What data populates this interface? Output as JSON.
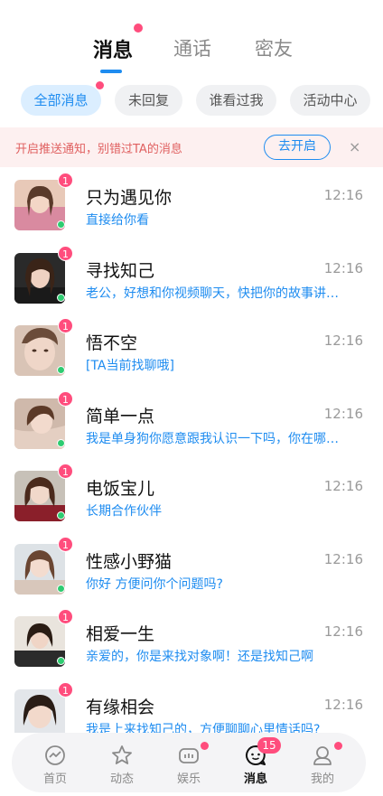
{
  "top_tabs": [
    {
      "label": "消息",
      "active": true
    },
    {
      "label": "通话",
      "active": false
    },
    {
      "label": "密友",
      "active": false
    }
  ],
  "filters": [
    {
      "label": "全部消息",
      "active": true
    },
    {
      "label": "未回复",
      "active": false
    },
    {
      "label": "谁看过我",
      "active": false
    },
    {
      "label": "活动中心",
      "active": false
    }
  ],
  "banner": {
    "text": "开启推送通知，别错过TA的消息",
    "button": "去开启",
    "close": "×"
  },
  "messages": [
    {
      "name": "只为遇见你",
      "time": "12:16",
      "preview": "直接给你看",
      "unread": "1",
      "online": true
    },
    {
      "name": "寻找知己",
      "time": "12:16",
      "preview": "老公，好想和你视频聊天，快把你的故事讲给我听",
      "unread": "1",
      "online": true
    },
    {
      "name": "悟不空",
      "time": "12:16",
      "preview": "[TA当前找聊哦]",
      "unread": "1",
      "online": true
    },
    {
      "name": "简单一点",
      "time": "12:16",
      "preview": "我是单身狗你愿意跟我认识一下吗，你在哪里呀",
      "unread": "1",
      "online": true
    },
    {
      "name": "电饭宝儿",
      "time": "12:16",
      "preview": "长期合作伙伴",
      "unread": "1",
      "online": true
    },
    {
      "name": "性感小野猫",
      "time": "12:16",
      "preview": "你好 方便问你个问题吗?",
      "unread": "1",
      "online": true
    },
    {
      "name": "相爱一生",
      "time": "12:16",
      "preview": "亲爱的，你是来找对象啊！还是找知己啊",
      "unread": "1",
      "online": true
    },
    {
      "name": "有缘相会",
      "time": "12:16",
      "preview": "我是上来找知己的，方便聊聊心里情话吗?",
      "unread": "1",
      "online": false
    }
  ],
  "bottom_nav": [
    {
      "label": "首页",
      "icon": "home-icon",
      "active": false
    },
    {
      "label": "动态",
      "icon": "star-icon",
      "active": false
    },
    {
      "label": "娱乐",
      "icon": "game-icon",
      "active": false
    },
    {
      "label": "消息",
      "icon": "chat-icon",
      "active": true,
      "count": "15"
    },
    {
      "label": "我的",
      "icon": "profile-icon",
      "active": false
    }
  ],
  "colors": {
    "accent": "#1e8cf0",
    "badge": "#ff4d7d",
    "online": "#2ecc71",
    "banner_bg": "#fdf0f0"
  }
}
